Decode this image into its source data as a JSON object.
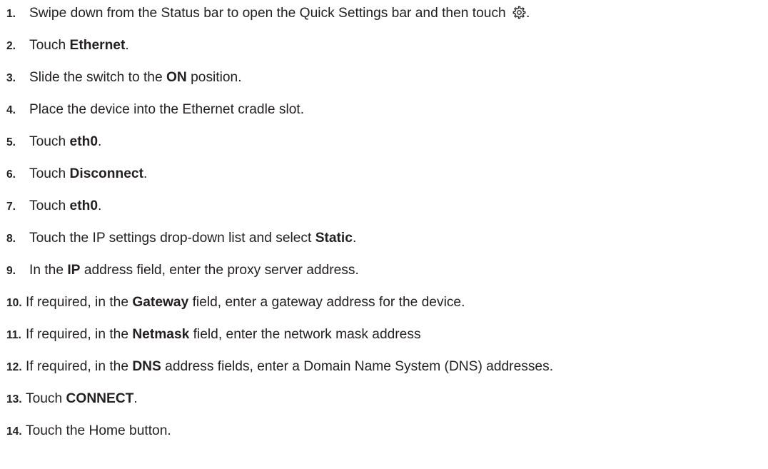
{
  "steps": [
    {
      "num": "1.",
      "parts": [
        {
          "text": "Swipe down from the Status bar to open the Quick Settings bar and then touch "
        },
        {
          "icon": "gear-icon"
        },
        {
          "text": "."
        }
      ]
    },
    {
      "num": "2.",
      "parts": [
        {
          "text": "Touch "
        },
        {
          "text": "Ethernet",
          "bold": true
        },
        {
          "text": "."
        }
      ]
    },
    {
      "num": "3.",
      "parts": [
        {
          "text": "Slide the switch to the "
        },
        {
          "text": "ON",
          "bold": true
        },
        {
          "text": " position."
        }
      ]
    },
    {
      "num": "4.",
      "parts": [
        {
          "text": "Place the device into the Ethernet cradle slot."
        }
      ]
    },
    {
      "num": "5.",
      "parts": [
        {
          "text": "Touch "
        },
        {
          "text": "eth0",
          "bold": true
        },
        {
          "text": "."
        }
      ]
    },
    {
      "num": "6.",
      "parts": [
        {
          "text": "Touch "
        },
        {
          "text": "Disconnect",
          "bold": true
        },
        {
          "text": "."
        }
      ]
    },
    {
      "num": "7.",
      "parts": [
        {
          "text": "Touch "
        },
        {
          "text": "eth0",
          "bold": true
        },
        {
          "text": "."
        }
      ]
    },
    {
      "num": "8.",
      "parts": [
        {
          "text": "Touch the IP settings drop-down list and select "
        },
        {
          "text": "Static",
          "bold": true
        },
        {
          "text": "."
        }
      ]
    },
    {
      "num": "9.",
      "parts": [
        {
          "text": "In the "
        },
        {
          "text": "IP",
          "bold": true
        },
        {
          "text": " address field, enter the proxy server address."
        }
      ]
    },
    {
      "num": "10.",
      "parts": [
        {
          "text": "If required, in the "
        },
        {
          "text": "Gateway",
          "bold": true
        },
        {
          "text": " field, enter a gateway address for the device."
        }
      ]
    },
    {
      "num": "11.",
      "parts": [
        {
          "text": "If required, in the "
        },
        {
          "text": "Netmask",
          "bold": true
        },
        {
          "text": " field, enter the network mask address"
        }
      ]
    },
    {
      "num": "12.",
      "parts": [
        {
          "text": "If required, in the "
        },
        {
          "text": "DNS",
          "bold": true
        },
        {
          "text": " address fields, enter a Domain Name System (DNS) addresses."
        }
      ]
    },
    {
      "num": "13.",
      "parts": [
        {
          "text": "Touch "
        },
        {
          "text": "CONNECT",
          "bold": true
        },
        {
          "text": "."
        }
      ]
    },
    {
      "num": "14.",
      "parts": [
        {
          "text": "Touch the Home button."
        }
      ]
    }
  ]
}
